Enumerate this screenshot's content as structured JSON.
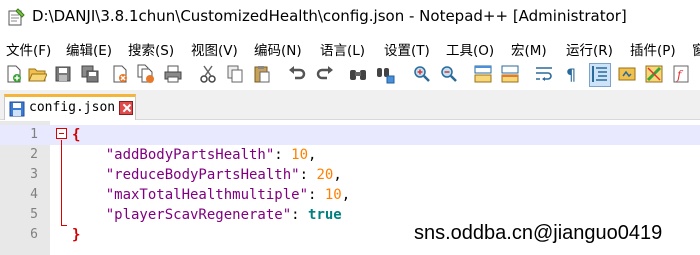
{
  "window": {
    "title": "D:\\DANJI\\3.8.1chun\\CustomizedHealth\\config.json - Notepad++ [Administrator]"
  },
  "menu": [
    {
      "id": "file",
      "label": "文件(F)"
    },
    {
      "id": "edit",
      "label": "编辑(E)"
    },
    {
      "id": "search",
      "label": "搜索(S)"
    },
    {
      "id": "view",
      "label": "视图(V)"
    },
    {
      "id": "encoding",
      "label": "编码(N)"
    },
    {
      "id": "language",
      "label": "语言(L)"
    },
    {
      "id": "settings",
      "label": "设置(T)"
    },
    {
      "id": "tools",
      "label": "工具(O)"
    },
    {
      "id": "macro",
      "label": "宏(M)"
    },
    {
      "id": "run",
      "label": "运行(R)"
    },
    {
      "id": "plugins",
      "label": "插件(P)"
    },
    {
      "id": "window",
      "label": "窗"
    }
  ],
  "toolbar": [
    {
      "id": "new",
      "icon": "new-file-icon"
    },
    {
      "id": "open",
      "icon": "open-folder-icon"
    },
    {
      "id": "save",
      "icon": "save-icon"
    },
    {
      "id": "save-all",
      "icon": "save-all-icon"
    },
    {
      "id": "close",
      "icon": "close-file-icon"
    },
    {
      "id": "close-all",
      "icon": "close-all-icon"
    },
    {
      "id": "print",
      "icon": "print-icon"
    },
    {
      "id": "cut",
      "icon": "cut-icon"
    },
    {
      "id": "copy",
      "icon": "copy-icon"
    },
    {
      "id": "paste",
      "icon": "paste-icon"
    },
    {
      "id": "undo",
      "icon": "undo-icon"
    },
    {
      "id": "redo",
      "icon": "redo-icon"
    },
    {
      "id": "find",
      "icon": "find-icon"
    },
    {
      "id": "replace",
      "icon": "replace-icon"
    },
    {
      "id": "zoom-in",
      "icon": "zoom-in-icon"
    },
    {
      "id": "zoom-out",
      "icon": "zoom-out-icon"
    },
    {
      "id": "sync-vertical",
      "icon": "sync-vertical-icon"
    },
    {
      "id": "sync-horizontal",
      "icon": "sync-horizontal-icon"
    },
    {
      "id": "word-wrap",
      "icon": "word-wrap-icon"
    },
    {
      "id": "show-all-chars",
      "icon": "pilcrow-icon"
    },
    {
      "id": "indent-guide",
      "icon": "indent-guide-icon",
      "active": true
    },
    {
      "id": "lang-define",
      "icon": "user-defined-language-icon"
    },
    {
      "id": "doc-map",
      "icon": "document-map-icon"
    },
    {
      "id": "function-list",
      "icon": "function-list-icon"
    }
  ],
  "tabs": [
    {
      "label": "config.json",
      "active": true
    }
  ],
  "editor": {
    "lines": [
      {
        "n": "1",
        "current": true,
        "tokens": [
          {
            "t": "{",
            "c": "brace"
          }
        ]
      },
      {
        "n": "2",
        "tokens": [
          {
            "t": "    ",
            "c": "punct"
          },
          {
            "t": "\"addBodyPartsHealth\"",
            "c": "key"
          },
          {
            "t": ": ",
            "c": "punct"
          },
          {
            "t": "10",
            "c": "num"
          },
          {
            "t": ",",
            "c": "punct"
          }
        ]
      },
      {
        "n": "3",
        "tokens": [
          {
            "t": "    ",
            "c": "punct"
          },
          {
            "t": "\"reduceBodyPartsHealth\"",
            "c": "key"
          },
          {
            "t": ": ",
            "c": "punct"
          },
          {
            "t": "20",
            "c": "num"
          },
          {
            "t": ",",
            "c": "punct"
          }
        ]
      },
      {
        "n": "4",
        "tokens": [
          {
            "t": "    ",
            "c": "punct"
          },
          {
            "t": "\"maxTotalHealthmultiple\"",
            "c": "key"
          },
          {
            "t": ": ",
            "c": "punct"
          },
          {
            "t": "10",
            "c": "num"
          },
          {
            "t": ",",
            "c": "punct"
          }
        ]
      },
      {
        "n": "5",
        "tokens": [
          {
            "t": "    ",
            "c": "punct"
          },
          {
            "t": "\"playerScavRegenerate\"",
            "c": "key"
          },
          {
            "t": ": ",
            "c": "punct"
          },
          {
            "t": "true",
            "c": "bool"
          }
        ]
      },
      {
        "n": "6",
        "tokens": [
          {
            "t": "}",
            "c": "brace"
          }
        ]
      }
    ]
  },
  "watermark": "sns.oddba.cn@jianguo0419",
  "colors": {
    "tab_accent": "#f4b53d",
    "current_line": "#e8e8ff",
    "gutter": "#e8e8e8",
    "fold_marker": "#dd0000"
  }
}
